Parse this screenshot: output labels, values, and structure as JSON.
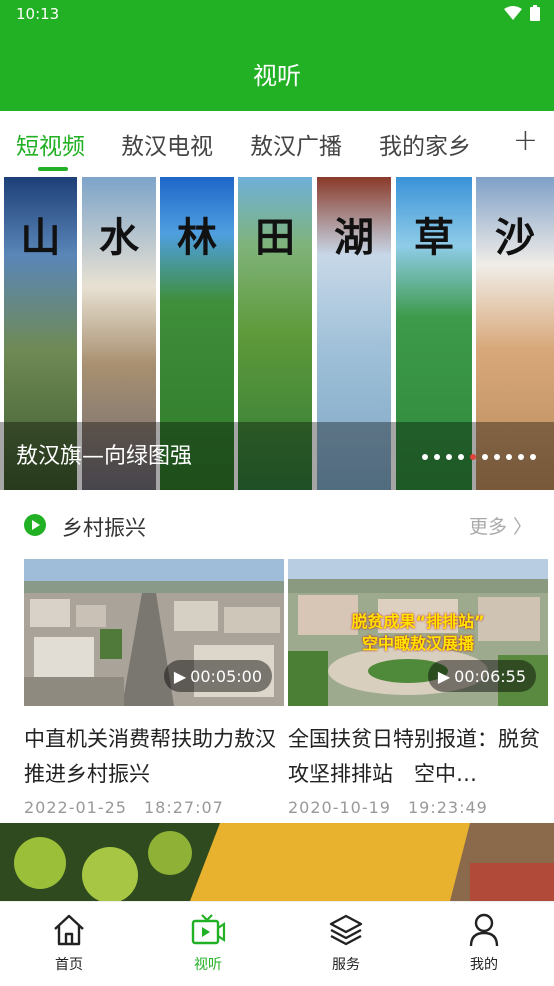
{
  "status_bar": {
    "time": "10:13"
  },
  "app_bar": {
    "title": "视听"
  },
  "tabs": [
    {
      "label": "短视频",
      "active": true
    },
    {
      "label": "敖汉电视"
    },
    {
      "label": "敖汉广播"
    },
    {
      "label": "我的家乡"
    }
  ],
  "tab_add_label": "+",
  "banner": {
    "strips": [
      "山",
      "水",
      "林",
      "田",
      "湖",
      "草",
      "沙"
    ],
    "caption": "敖汉旗—向绿图强",
    "dot_count": 10,
    "active_dot": 4
  },
  "section": {
    "title": "乡村振兴",
    "more": "更多 〉"
  },
  "videos": [
    {
      "title": "中直机关消费帮扶助力敖汉推进乡村振兴",
      "duration": "00:05:00",
      "date": "2022-01-25　18:27:07"
    },
    {
      "title": "全国扶贫日特别报道：脱贫攻坚排排站　空中…",
      "duration": "00:06:55",
      "date": "2020-10-19　19:23:49",
      "overlay_lines": [
        "脱贫成果“排排站”",
        "空中瞰敖汉展播"
      ]
    }
  ],
  "bottom_nav": [
    {
      "label": "首页"
    },
    {
      "label": "视听",
      "active": true
    },
    {
      "label": "服务"
    },
    {
      "label": "我的"
    }
  ],
  "colors": {
    "brand_green": "#22b024",
    "active_dot": "#e0443a"
  }
}
